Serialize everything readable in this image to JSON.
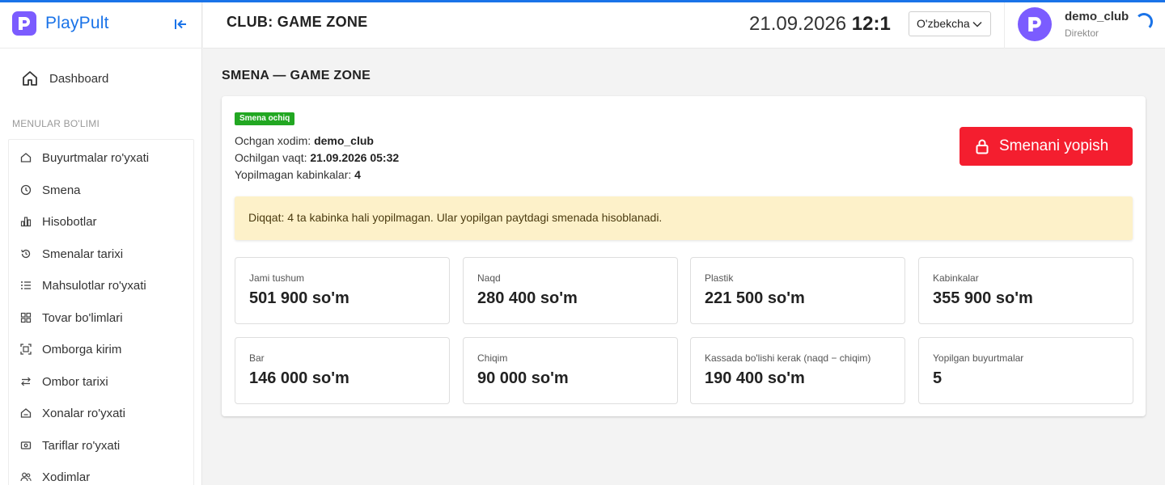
{
  "brand": {
    "name": "PlayPult"
  },
  "sidebar": {
    "dashboard": "Dashboard",
    "section_label": "MENULAR BO'LIMI",
    "items": [
      {
        "label": "Buyurtmalar ro'yxati",
        "icon": "home-icon"
      },
      {
        "label": "Smena",
        "icon": "clock-icon"
      },
      {
        "label": "Hisobotlar",
        "icon": "bar-chart-icon"
      },
      {
        "label": "Smenalar tarixi",
        "icon": "history-icon"
      },
      {
        "label": "Mahsulotlar ro'yxati",
        "icon": "list-icon"
      },
      {
        "label": "Tovar bo'limlari",
        "icon": "grid-icon"
      },
      {
        "label": "Omborga kirim",
        "icon": "scan-icon"
      },
      {
        "label": "Ombor tarixi",
        "icon": "transfer-icon"
      },
      {
        "label": "Xonalar ro'yxati",
        "icon": "room-icon"
      },
      {
        "label": "Tariflar ro'yxati",
        "icon": "ticket-icon"
      },
      {
        "label": "Xodimlar",
        "icon": "users-icon"
      }
    ]
  },
  "header": {
    "club_title": "CLUB: GAME ZONE",
    "date": "21.09.2026",
    "time": "12:1",
    "language": "O'zbekcha",
    "user_name": "demo_club",
    "user_role": "Direktor"
  },
  "main": {
    "heading": "SMENA — GAME ZONE",
    "badge": "Smena ochiq",
    "opened_by_label": "Ochgan xodim:",
    "opened_by": "demo_club",
    "opened_at_label": "Ochilgan vaqt:",
    "opened_at": "21.09.2026 05:32",
    "unclosed_label": "Yopilmagan kabinkalar:",
    "unclosed": "4",
    "close_button": "Smenani yopish",
    "alert": "Diqqat: 4 ta kabinka hali yopilmagan. Ular yopilgan paytdagi smenada hisoblanadi.",
    "stats": [
      {
        "label": "Jami tushum",
        "value": "501 900 so'm"
      },
      {
        "label": "Naqd",
        "value": "280 400 so'm"
      },
      {
        "label": "Plastik",
        "value": "221 500 so'm"
      },
      {
        "label": "Kabinkalar",
        "value": "355 900 so'm"
      },
      {
        "label": "Bar",
        "value": "146 000 so'm"
      },
      {
        "label": "Chiqim",
        "value": "90 000 so'm"
      },
      {
        "label": "Kassada bo'lishi kerak (naqd − chiqim)",
        "value": "190 400 so'm"
      },
      {
        "label": "Yopilgan buyurtmalar",
        "value": "5"
      }
    ]
  },
  "colors": {
    "accent": "#1a73e8",
    "brand": "#7b5cff",
    "danger": "#f41e2f",
    "success": "#22a722",
    "warning_bg": "#fdf1c9"
  }
}
